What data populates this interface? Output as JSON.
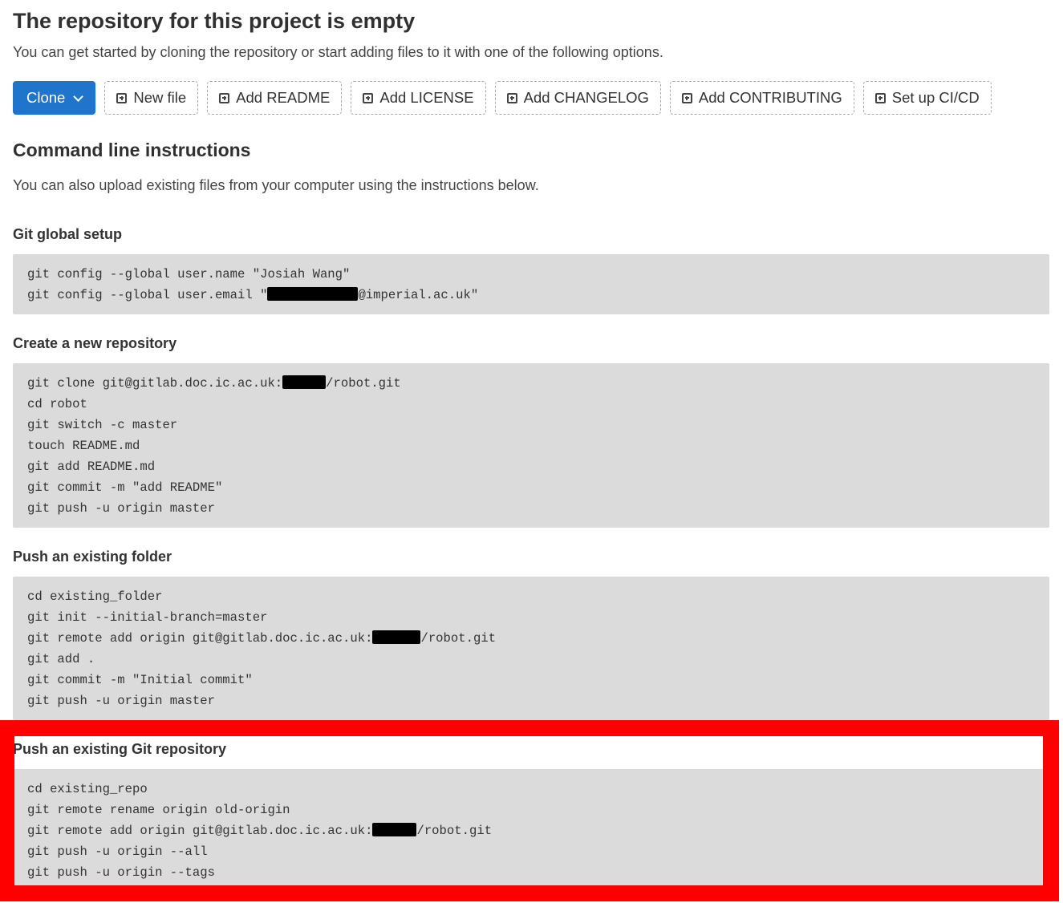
{
  "header": {
    "title": "The repository for this project is empty",
    "subtitle": "You can get started by cloning the repository or start adding files to it with one of the following options."
  },
  "actions": {
    "clone_label": "Clone",
    "buttons": [
      {
        "label": "New file",
        "icon": "plus-square-icon"
      },
      {
        "label": "Add README",
        "icon": "plus-square-icon"
      },
      {
        "label": "Add LICENSE",
        "icon": "plus-square-icon"
      },
      {
        "label": "Add CHANGELOG",
        "icon": "plus-square-icon"
      },
      {
        "label": "Add CONTRIBUTING",
        "icon": "plus-square-icon"
      },
      {
        "label": "Set up CI/CD",
        "icon": "plus-square-icon"
      }
    ]
  },
  "instructions": {
    "title": "Command line instructions",
    "description": "You can also upload existing files from your computer using the instructions below.",
    "sections": [
      {
        "heading": "Git global setup",
        "lines": [
          {
            "pre": "git config --global user.name \"Josiah Wang\""
          },
          {
            "pre": "git config --global user.email \"",
            "redacted": true,
            "post": "@imperial.ac.uk\""
          }
        ]
      },
      {
        "heading": "Create a new repository",
        "lines": [
          {
            "pre": "git clone git@gitlab.doc.ic.ac.uk:",
            "redacted": true,
            "post": "/robot.git"
          },
          {
            "pre": "cd robot"
          },
          {
            "pre": "git switch -c master"
          },
          {
            "pre": "touch README.md"
          },
          {
            "pre": "git add README.md"
          },
          {
            "pre": "git commit -m \"add README\""
          },
          {
            "pre": "git push -u origin master"
          }
        ]
      },
      {
        "heading": "Push an existing folder",
        "lines": [
          {
            "pre": "cd existing_folder"
          },
          {
            "pre": "git init --initial-branch=master"
          },
          {
            "pre": "git remote add origin git@gitlab.doc.ic.ac.uk:",
            "redacted": true,
            "post": "/robot.git"
          },
          {
            "pre": "git add ."
          },
          {
            "pre": "git commit -m \"Initial commit\""
          },
          {
            "pre": "git push -u origin master"
          }
        ]
      },
      {
        "heading": "Push an existing Git repository",
        "lines": [
          {
            "pre": "cd existing_repo"
          },
          {
            "pre": "git remote rename origin old-origin"
          },
          {
            "pre": "git remote add origin git@gitlab.doc.ic.ac.uk:",
            "redacted": true,
            "post": "/robot.git"
          },
          {
            "pre": "git push -u origin --all"
          },
          {
            "pre": "git push -u origin --tags"
          }
        ]
      }
    ]
  },
  "colors": {
    "primary": "#1f75cb",
    "highlight": "#ff0000",
    "code_bg": "#dbdbdb"
  }
}
